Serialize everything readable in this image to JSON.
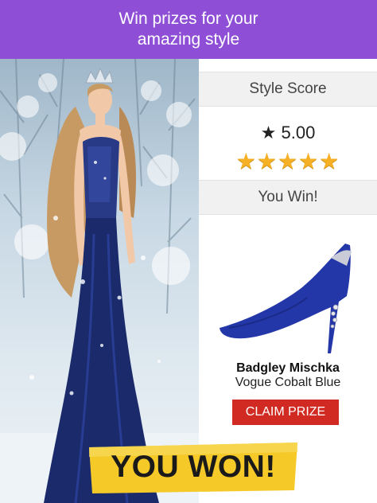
{
  "header": {
    "line1": "Win prizes for your",
    "line2": "amazing style"
  },
  "panel": {
    "style_score_label": "Style Score",
    "score_value": "★ 5.00",
    "stars": "★★★★★",
    "result_label": "You Win!",
    "prize": {
      "brand": "Badgley Mischka",
      "name": "Vogue Cobalt Blue"
    },
    "claim_label": "CLAIM PRIZE"
  },
  "banner": {
    "text": "YOU WON!"
  },
  "colors": {
    "header_bg": "#8e4fd6",
    "claim_bg": "#d12a22",
    "star": "#f5b026",
    "banner": "#f4c928",
    "gown": "#1b2a6b"
  },
  "icons": [
    "star-icon",
    "crown-icon",
    "high-heel-icon"
  ]
}
